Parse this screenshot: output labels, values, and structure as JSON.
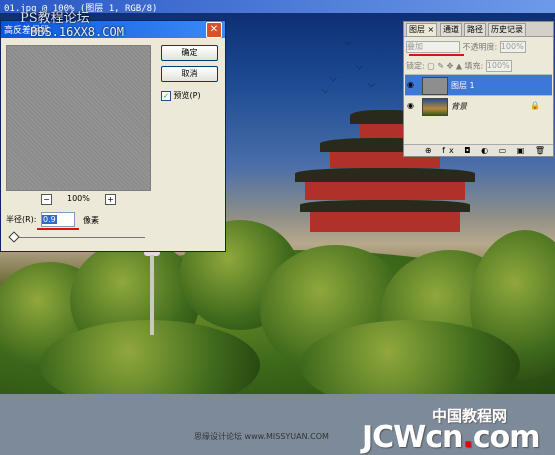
{
  "window": {
    "title": "01.jpg @ 100% (图层 1, RGB/8)"
  },
  "watermark": {
    "line1": "PS教程论坛",
    "line2": "BBS.16XX8.COM"
  },
  "dialog": {
    "title": "高反差保留",
    "ok_label": "确定",
    "cancel_label": "取消",
    "preview_label": "预览(P)",
    "preview_checked": "✓",
    "zoom_out": "−",
    "zoom_in": "+",
    "zoom_level": "100%",
    "radius_label": "半径(R):",
    "radius_value": "0.9",
    "radius_unit": "像素"
  },
  "layers_panel": {
    "tabs": [
      "图层",
      "通道",
      "路径",
      "历史记录"
    ],
    "tab_close": "×",
    "blend_mode": "叠加",
    "opacity_label": "不透明度:",
    "opacity_value": "100%",
    "lock_label": "锁定:",
    "fill_label": "填充:",
    "fill_value": "100%",
    "layers": [
      {
        "name": "图层 1"
      },
      {
        "name": "背景"
      }
    ],
    "bottom_icons": "⊕ fx ◘ ◐ ▭ ▣ 🗑"
  },
  "footer": {
    "site_cn": "中国教程网",
    "forum": "思缘设计论坛 www.MISSYUAN.COM",
    "brand": "JCWcn",
    "brand_dot": ".",
    "brand_tld": "com"
  },
  "colors": {
    "accent_red": "#dd1111",
    "dialog_title": "#0a55e0"
  }
}
